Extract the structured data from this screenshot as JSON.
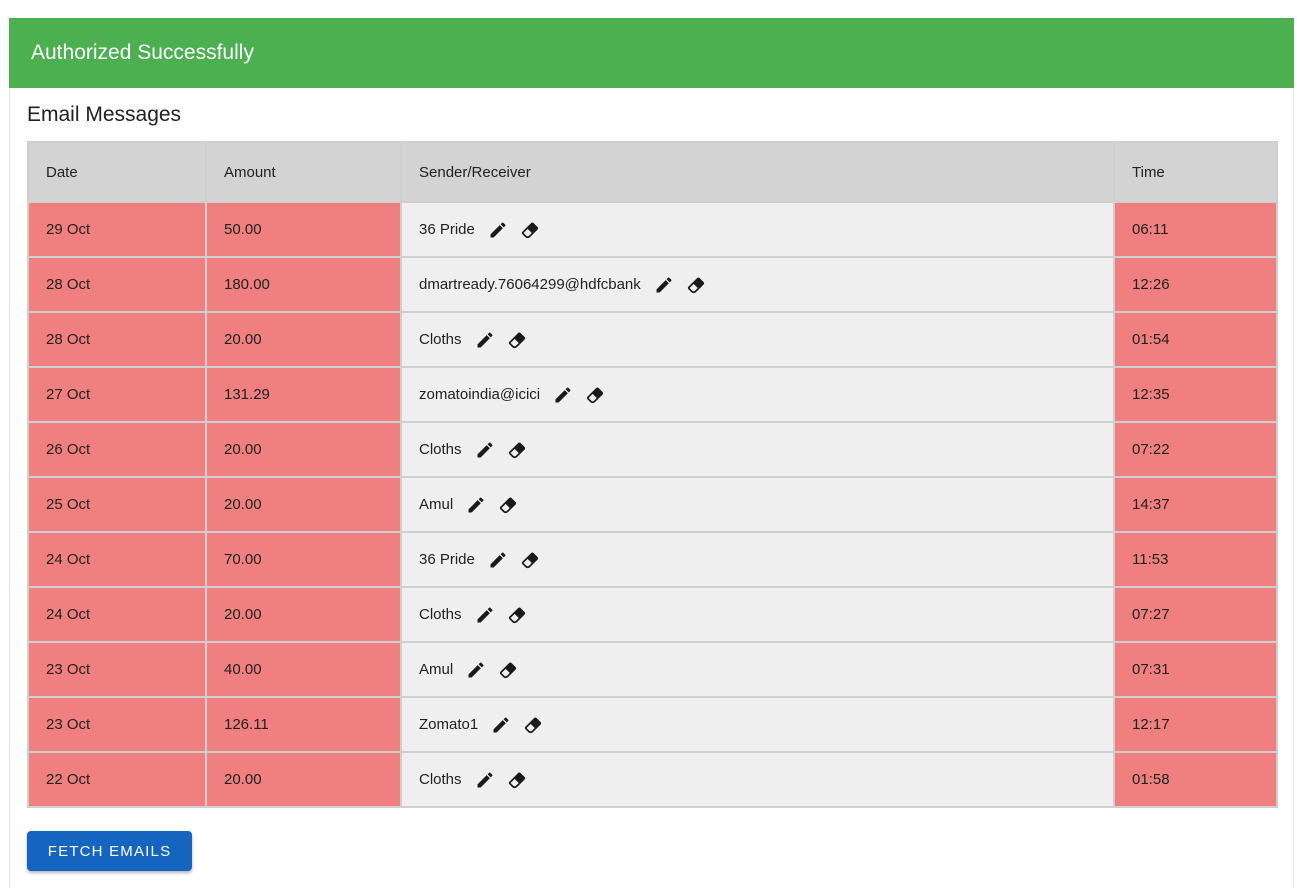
{
  "alert": {
    "text": "Authorized Successfully",
    "color": "#4caf50"
  },
  "section": {
    "title": "Email Messages"
  },
  "table": {
    "headers": {
      "date": "Date",
      "amount": "Amount",
      "sender": "Sender/Receiver",
      "time": "Time"
    },
    "rows": [
      {
        "date": "29 Oct",
        "amount": "50.00",
        "sender": "36 Pride",
        "time": "06:11"
      },
      {
        "date": "28 Oct",
        "amount": "180.00",
        "sender": "dmartready.76064299@hdfcbank",
        "time": "12:26"
      },
      {
        "date": "28 Oct",
        "amount": "20.00",
        "sender": "Cloths",
        "time": "01:54"
      },
      {
        "date": "27 Oct",
        "amount": "131.29",
        "sender": "zomatoindia@icici",
        "time": "12:35"
      },
      {
        "date": "26 Oct",
        "amount": "20.00",
        "sender": "Cloths",
        "time": "07:22"
      },
      {
        "date": "25 Oct",
        "amount": "20.00",
        "sender": "Amul",
        "time": "14:37"
      },
      {
        "date": "24 Oct",
        "amount": "70.00",
        "sender": "36 Pride",
        "time": "11:53"
      },
      {
        "date": "24 Oct",
        "amount": "20.00",
        "sender": "Cloths",
        "time": "07:27"
      },
      {
        "date": "23 Oct",
        "amount": "40.00",
        "sender": "Amul",
        "time": "07:31"
      },
      {
        "date": "23 Oct",
        "amount": "126.11",
        "sender": "Zomato1",
        "time": "12:17"
      },
      {
        "date": "22 Oct",
        "amount": "20.00",
        "sender": "Cloths",
        "time": "01:58"
      }
    ],
    "row_color": "#f08080",
    "sender_cell_color": "#efefef",
    "row_icons": [
      "pencil-icon",
      "eraser-icon"
    ]
  },
  "actions": {
    "fetch_label": "Fetch Emails",
    "fetch_color": "#1565c0"
  }
}
